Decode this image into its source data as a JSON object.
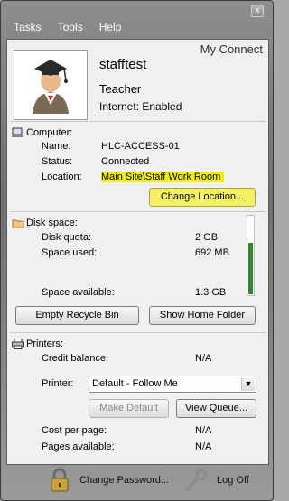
{
  "menu": [
    "Tasks",
    "Tools",
    "Help"
  ],
  "window": {
    "close_glyph": "x"
  },
  "brand": "My Connect",
  "user": {
    "name": "stafftest",
    "role": "Teacher",
    "internet": "Internet: Enabled",
    "avatar_icon": "graduate-avatar-icon"
  },
  "computer": {
    "heading": "Computer:",
    "name_label": "Name:",
    "name_value": "HLC-ACCESS-01",
    "status_label": "Status:",
    "status_value": "Connected",
    "location_label": "Location:",
    "location_value": "Main Site\\Staff Work Room",
    "change_location_button": "Change Location..."
  },
  "disk": {
    "heading": "Disk space:",
    "quota_label": "Disk quota:",
    "quota_value": "2 GB",
    "used_label": "Space used:",
    "used_value": "692 MB",
    "available_label": "Space available:",
    "available_value": "1.3 GB",
    "available_fraction": 0.65,
    "empty_recycle_button": "Empty Recycle Bin",
    "show_home_button": "Show Home Folder"
  },
  "printers": {
    "heading": "Printers:",
    "credit_label": "Credit balance:",
    "credit_value": "N/A",
    "printer_label": "Printer:",
    "printer_selected": "Default - Follow Me",
    "make_default_button": "Make Default",
    "view_queue_button": "View Queue...",
    "cost_label": "Cost per page:",
    "cost_value": "N/A",
    "pages_label": "Pages available:",
    "pages_value": "N/A"
  },
  "footer": {
    "change_password": "Change Password...",
    "log_off": "Log Off"
  },
  "colors": {
    "highlight": "#f0f000",
    "usage_fill": "#2d8a2d"
  }
}
